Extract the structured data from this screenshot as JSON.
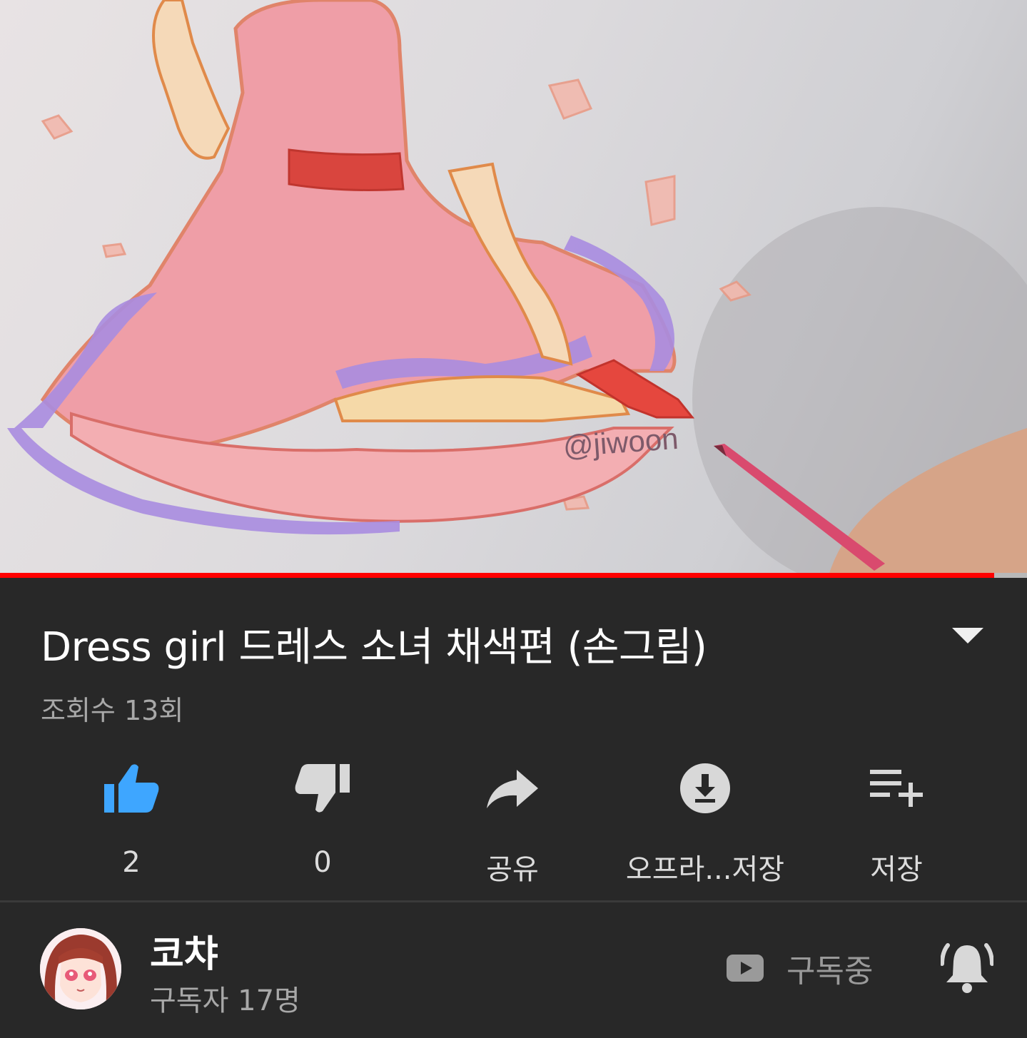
{
  "video": {
    "watermark": "@jiwoon",
    "progress_fraction": 0.968
  },
  "title": "Dress girl 드레스 소녀 채색편 (손그림)",
  "views": "조회수 13회",
  "actions": {
    "like": {
      "label": "2",
      "icon": "thumbs-up-icon",
      "color": "#3ea6ff"
    },
    "dislike": {
      "label": "0",
      "icon": "thumbs-down-icon"
    },
    "share": {
      "label": "공유",
      "icon": "share-icon"
    },
    "download": {
      "label": "오프라...저장",
      "icon": "download-icon"
    },
    "save": {
      "label": "저장",
      "icon": "playlist-add-icon"
    }
  },
  "channel": {
    "name": "코챠",
    "subscribers": "구독자 17명",
    "subscribed_label": "구독중"
  },
  "colors": {
    "background": "#282828",
    "progress": "#ff0000",
    "like_active": "#3ea6ff"
  }
}
